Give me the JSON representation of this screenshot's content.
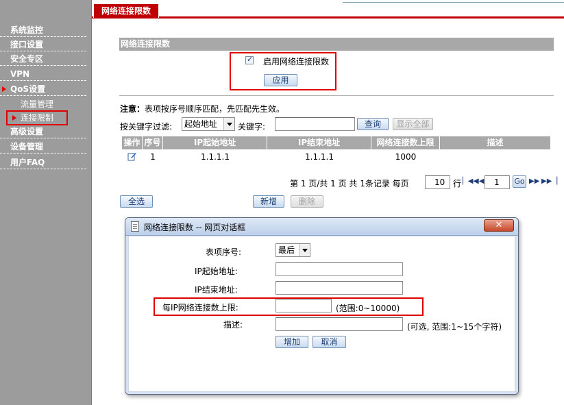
{
  "sidebar": {
    "items": [
      {
        "label": "系统监控"
      },
      {
        "label": "接口设置"
      },
      {
        "label": "安全专区"
      },
      {
        "label": "VPN"
      },
      {
        "label": "QoS设置"
      },
      {
        "label": "流量管理"
      },
      {
        "label": "连接限制"
      },
      {
        "label": "高级设置"
      },
      {
        "label": "设备管理"
      },
      {
        "label": "用户FAQ"
      }
    ]
  },
  "header": {
    "tab_label": "网络连接限数"
  },
  "section": {
    "title": "网络连接限数",
    "enable_label": "启用网络连接限数",
    "enable_checked": true,
    "apply_label": "应用"
  },
  "note": {
    "prefix": "注意：",
    "text": "表项按序号顺序匹配，先匹配先生效。"
  },
  "filter": {
    "label": "按关键字过滤:",
    "select_value": "起始地址",
    "keyword_label": "关键字:",
    "keyword_value": "",
    "query_label": "查询",
    "show_all_label": "显示全部"
  },
  "table": {
    "columns": [
      "操作",
      "序号",
      "IP起始地址",
      "IP结束地址",
      "网络连接数上限",
      "描述"
    ],
    "rows": [
      {
        "index": "1",
        "start_ip": "1.1.1.1",
        "end_ip": "1.1.1.1",
        "limit": "1000",
        "desc": ""
      }
    ]
  },
  "pager": {
    "text1": "第 1 页/共 1 页 共 1条记录 每页",
    "per_page": "10",
    "text2": "行",
    "page_value": "1",
    "go_label": "Go"
  },
  "actions": {
    "select_all": "全选",
    "add": "新增",
    "delete": "删除"
  },
  "dialog": {
    "title": "网络连接限数 -- 网页对话框",
    "close_glyph": "✕",
    "fields": {
      "index_label": "表项序号:",
      "index_value": "最后",
      "start_label": "IP起始地址:",
      "end_label": "IP结束地址:",
      "limit_label": "每IP网络连接数上限:",
      "limit_hint": "(范围:0~10000)",
      "desc_label": "描述:",
      "desc_hint": "(可选, 范围:1~15个字符)"
    },
    "add_label": "增加",
    "cancel_label": "取消"
  },
  "colors": {
    "accent_red": "#c00000",
    "sidebar_gray": "#9c9c9c",
    "header_gray": "#a8a8a8"
  }
}
